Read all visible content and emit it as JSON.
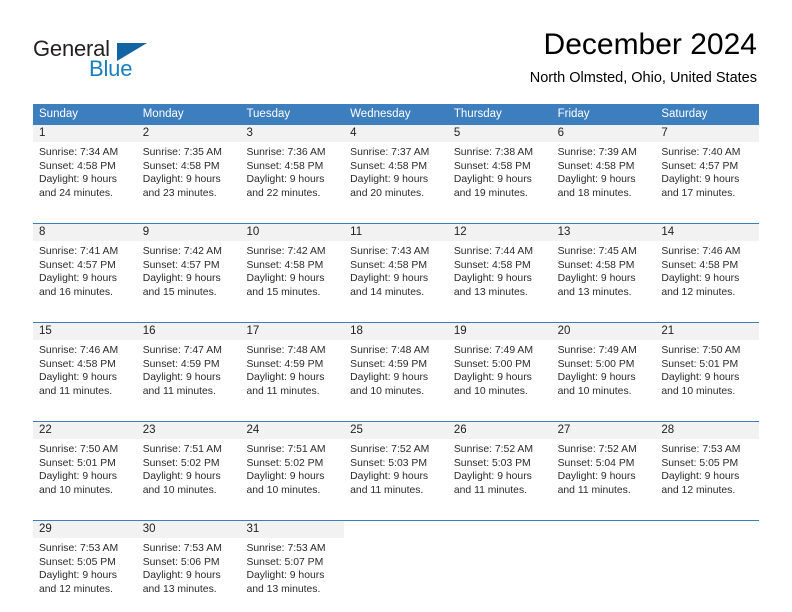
{
  "logo": {
    "word_one": "General",
    "word_two": "Blue",
    "triangle": "triangle-glyph",
    "primary_color": "#1264a3",
    "text_color": "#231f20",
    "blue_text_color": "#1a7fc1"
  },
  "header": {
    "title": "December 2024",
    "subtitle": "North Olmsted, Ohio, United States"
  },
  "theme": {
    "header_blue": "#3d7ebe",
    "daynum_gray": "#f2f2f2",
    "text_black": "#000000"
  },
  "calendar": {
    "weekday_headers": [
      "Sunday",
      "Monday",
      "Tuesday",
      "Wednesday",
      "Thursday",
      "Friday",
      "Saturday"
    ],
    "weeks": [
      [
        {
          "day": "1",
          "sunrise": "Sunrise: 7:34 AM",
          "sunset": "Sunset: 4:58 PM",
          "daylight_line1": "Daylight: 9 hours",
          "daylight_line2": "and 24 minutes."
        },
        {
          "day": "2",
          "sunrise": "Sunrise: 7:35 AM",
          "sunset": "Sunset: 4:58 PM",
          "daylight_line1": "Daylight: 9 hours",
          "daylight_line2": "and 23 minutes."
        },
        {
          "day": "3",
          "sunrise": "Sunrise: 7:36 AM",
          "sunset": "Sunset: 4:58 PM",
          "daylight_line1": "Daylight: 9 hours",
          "daylight_line2": "and 22 minutes."
        },
        {
          "day": "4",
          "sunrise": "Sunrise: 7:37 AM",
          "sunset": "Sunset: 4:58 PM",
          "daylight_line1": "Daylight: 9 hours",
          "daylight_line2": "and 20 minutes."
        },
        {
          "day": "5",
          "sunrise": "Sunrise: 7:38 AM",
          "sunset": "Sunset: 4:58 PM",
          "daylight_line1": "Daylight: 9 hours",
          "daylight_line2": "and 19 minutes."
        },
        {
          "day": "6",
          "sunrise": "Sunrise: 7:39 AM",
          "sunset": "Sunset: 4:58 PM",
          "daylight_line1": "Daylight: 9 hours",
          "daylight_line2": "and 18 minutes."
        },
        {
          "day": "7",
          "sunrise": "Sunrise: 7:40 AM",
          "sunset": "Sunset: 4:57 PM",
          "daylight_line1": "Daylight: 9 hours",
          "daylight_line2": "and 17 minutes."
        }
      ],
      [
        {
          "day": "8",
          "sunrise": "Sunrise: 7:41 AM",
          "sunset": "Sunset: 4:57 PM",
          "daylight_line1": "Daylight: 9 hours",
          "daylight_line2": "and 16 minutes."
        },
        {
          "day": "9",
          "sunrise": "Sunrise: 7:42 AM",
          "sunset": "Sunset: 4:57 PM",
          "daylight_line1": "Daylight: 9 hours",
          "daylight_line2": "and 15 minutes."
        },
        {
          "day": "10",
          "sunrise": "Sunrise: 7:42 AM",
          "sunset": "Sunset: 4:58 PM",
          "daylight_line1": "Daylight: 9 hours",
          "daylight_line2": "and 15 minutes."
        },
        {
          "day": "11",
          "sunrise": "Sunrise: 7:43 AM",
          "sunset": "Sunset: 4:58 PM",
          "daylight_line1": "Daylight: 9 hours",
          "daylight_line2": "and 14 minutes."
        },
        {
          "day": "12",
          "sunrise": "Sunrise: 7:44 AM",
          "sunset": "Sunset: 4:58 PM",
          "daylight_line1": "Daylight: 9 hours",
          "daylight_line2": "and 13 minutes."
        },
        {
          "day": "13",
          "sunrise": "Sunrise: 7:45 AM",
          "sunset": "Sunset: 4:58 PM",
          "daylight_line1": "Daylight: 9 hours",
          "daylight_line2": "and 13 minutes."
        },
        {
          "day": "14",
          "sunrise": "Sunrise: 7:46 AM",
          "sunset": "Sunset: 4:58 PM",
          "daylight_line1": "Daylight: 9 hours",
          "daylight_line2": "and 12 minutes."
        }
      ],
      [
        {
          "day": "15",
          "sunrise": "Sunrise: 7:46 AM",
          "sunset": "Sunset: 4:58 PM",
          "daylight_line1": "Daylight: 9 hours",
          "daylight_line2": "and 11 minutes."
        },
        {
          "day": "16",
          "sunrise": "Sunrise: 7:47 AM",
          "sunset": "Sunset: 4:59 PM",
          "daylight_line1": "Daylight: 9 hours",
          "daylight_line2": "and 11 minutes."
        },
        {
          "day": "17",
          "sunrise": "Sunrise: 7:48 AM",
          "sunset": "Sunset: 4:59 PM",
          "daylight_line1": "Daylight: 9 hours",
          "daylight_line2": "and 11 minutes."
        },
        {
          "day": "18",
          "sunrise": "Sunrise: 7:48 AM",
          "sunset": "Sunset: 4:59 PM",
          "daylight_line1": "Daylight: 9 hours",
          "daylight_line2": "and 10 minutes."
        },
        {
          "day": "19",
          "sunrise": "Sunrise: 7:49 AM",
          "sunset": "Sunset: 5:00 PM",
          "daylight_line1": "Daylight: 9 hours",
          "daylight_line2": "and 10 minutes."
        },
        {
          "day": "20",
          "sunrise": "Sunrise: 7:49 AM",
          "sunset": "Sunset: 5:00 PM",
          "daylight_line1": "Daylight: 9 hours",
          "daylight_line2": "and 10 minutes."
        },
        {
          "day": "21",
          "sunrise": "Sunrise: 7:50 AM",
          "sunset": "Sunset: 5:01 PM",
          "daylight_line1": "Daylight: 9 hours",
          "daylight_line2": "and 10 minutes."
        }
      ],
      [
        {
          "day": "22",
          "sunrise": "Sunrise: 7:50 AM",
          "sunset": "Sunset: 5:01 PM",
          "daylight_line1": "Daylight: 9 hours",
          "daylight_line2": "and 10 minutes."
        },
        {
          "day": "23",
          "sunrise": "Sunrise: 7:51 AM",
          "sunset": "Sunset: 5:02 PM",
          "daylight_line1": "Daylight: 9 hours",
          "daylight_line2": "and 10 minutes."
        },
        {
          "day": "24",
          "sunrise": "Sunrise: 7:51 AM",
          "sunset": "Sunset: 5:02 PM",
          "daylight_line1": "Daylight: 9 hours",
          "daylight_line2": "and 10 minutes."
        },
        {
          "day": "25",
          "sunrise": "Sunrise: 7:52 AM",
          "sunset": "Sunset: 5:03 PM",
          "daylight_line1": "Daylight: 9 hours",
          "daylight_line2": "and 11 minutes."
        },
        {
          "day": "26",
          "sunrise": "Sunrise: 7:52 AM",
          "sunset": "Sunset: 5:03 PM",
          "daylight_line1": "Daylight: 9 hours",
          "daylight_line2": "and 11 minutes."
        },
        {
          "day": "27",
          "sunrise": "Sunrise: 7:52 AM",
          "sunset": "Sunset: 5:04 PM",
          "daylight_line1": "Daylight: 9 hours",
          "daylight_line2": "and 11 minutes."
        },
        {
          "day": "28",
          "sunrise": "Sunrise: 7:53 AM",
          "sunset": "Sunset: 5:05 PM",
          "daylight_line1": "Daylight: 9 hours",
          "daylight_line2": "and 12 minutes."
        }
      ],
      [
        {
          "day": "29",
          "sunrise": "Sunrise: 7:53 AM",
          "sunset": "Sunset: 5:05 PM",
          "daylight_line1": "Daylight: 9 hours",
          "daylight_line2": "and 12 minutes."
        },
        {
          "day": "30",
          "sunrise": "Sunrise: 7:53 AM",
          "sunset": "Sunset: 5:06 PM",
          "daylight_line1": "Daylight: 9 hours",
          "daylight_line2": "and 13 minutes."
        },
        {
          "day": "31",
          "sunrise": "Sunrise: 7:53 AM",
          "sunset": "Sunset: 5:07 PM",
          "daylight_line1": "Daylight: 9 hours",
          "daylight_line2": "and 13 minutes."
        },
        {
          "day": "",
          "sunrise": "",
          "sunset": "",
          "daylight_line1": "",
          "daylight_line2": ""
        },
        {
          "day": "",
          "sunrise": "",
          "sunset": "",
          "daylight_line1": "",
          "daylight_line2": ""
        },
        {
          "day": "",
          "sunrise": "",
          "sunset": "",
          "daylight_line1": "",
          "daylight_line2": ""
        },
        {
          "day": "",
          "sunrise": "",
          "sunset": "",
          "daylight_line1": "",
          "daylight_line2": ""
        }
      ]
    ]
  }
}
